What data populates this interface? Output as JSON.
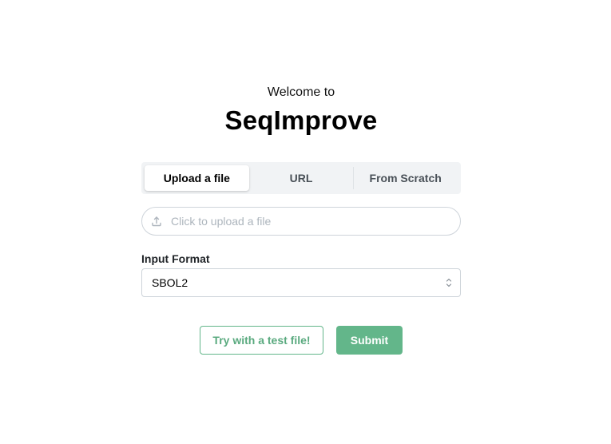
{
  "header": {
    "welcome": "Welcome to",
    "title": "SeqImprove"
  },
  "source_tabs": {
    "items": [
      {
        "label": "Upload a file",
        "active": true
      },
      {
        "label": "URL",
        "active": false
      },
      {
        "label": "From Scratch",
        "active": false
      }
    ]
  },
  "upload": {
    "placeholder": "Click to upload a file",
    "icon": "upload-icon"
  },
  "input_format": {
    "label": "Input Format",
    "selected": "SBOL2",
    "icon": "chevron-up-down-icon"
  },
  "actions": {
    "try_label": "Try with a test file!",
    "submit_label": "Submit"
  },
  "colors": {
    "accent": "#63b68a",
    "segment_bg": "#f1f3f5",
    "border": "#ced4da",
    "placeholder": "#adb5bd"
  }
}
